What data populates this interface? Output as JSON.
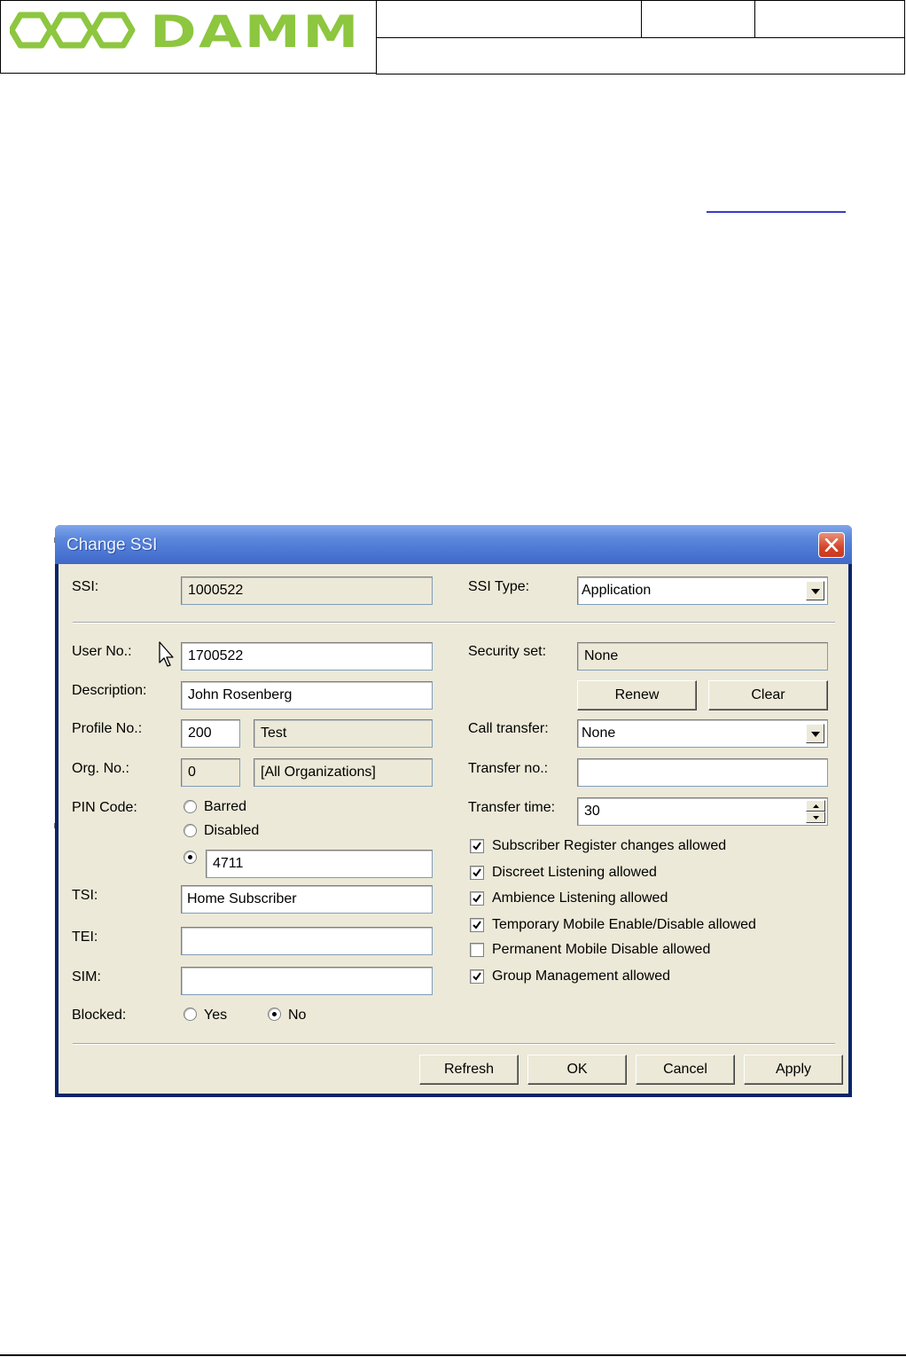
{
  "document": {
    "logo_text": "DAMM"
  },
  "dialog": {
    "title": "Change SSI",
    "left": {
      "ssi": {
        "label": "SSI:",
        "value": "1000522"
      },
      "user_no": {
        "label": "User No.:",
        "value": "1700522"
      },
      "description": {
        "label": "Description:",
        "value": "John Rosenberg"
      },
      "profile_no": {
        "label": "Profile No.:",
        "value": "200",
        "name": "Test"
      },
      "org_no": {
        "label": "Org. No.:",
        "value": "0",
        "name": "[All Organizations]"
      },
      "pin_code": {
        "label": "PIN Code:",
        "options": [
          "Barred",
          "Disabled"
        ],
        "selected": "custom",
        "value": "4711"
      },
      "tsi": {
        "label": "TSI:",
        "value": "Home Subscriber"
      },
      "tei": {
        "label": "TEI:",
        "value": ""
      },
      "sim": {
        "label": "SIM:",
        "value": ""
      },
      "blocked": {
        "label": "Blocked:",
        "yes": "Yes",
        "no": "No",
        "selected": "No"
      }
    },
    "right": {
      "ssi_type": {
        "label": "SSI Type:",
        "value": "Application"
      },
      "security_set": {
        "label": "Security set:",
        "value": "None"
      },
      "renew_label": "Renew",
      "clear_label": "Clear",
      "call_transfer": {
        "label": "Call transfer:",
        "value": "None"
      },
      "transfer_no": {
        "label": "Transfer no.:",
        "value": ""
      },
      "transfer_time": {
        "label": "Transfer time:",
        "value": "30"
      },
      "permissions": [
        {
          "label": "Subscriber Register changes allowed",
          "checked": true
        },
        {
          "label": "Discreet Listening allowed",
          "checked": true
        },
        {
          "label": "Ambience Listening allowed",
          "checked": true
        },
        {
          "label": "Temporary Mobile Enable/Disable allowed",
          "checked": true
        },
        {
          "label": "Permanent Mobile Disable allowed",
          "checked": false
        },
        {
          "label": "Group Management allowed",
          "checked": true
        }
      ]
    },
    "buttons": {
      "refresh": "Refresh",
      "ok": "OK",
      "cancel": "Cancel",
      "apply": "Apply"
    }
  },
  "colors": {
    "logo_green": "#8dc63f",
    "title_bar": "#4b76d2",
    "dialog_bg": "#ece9d8",
    "link_blue": "#3a3acb"
  }
}
